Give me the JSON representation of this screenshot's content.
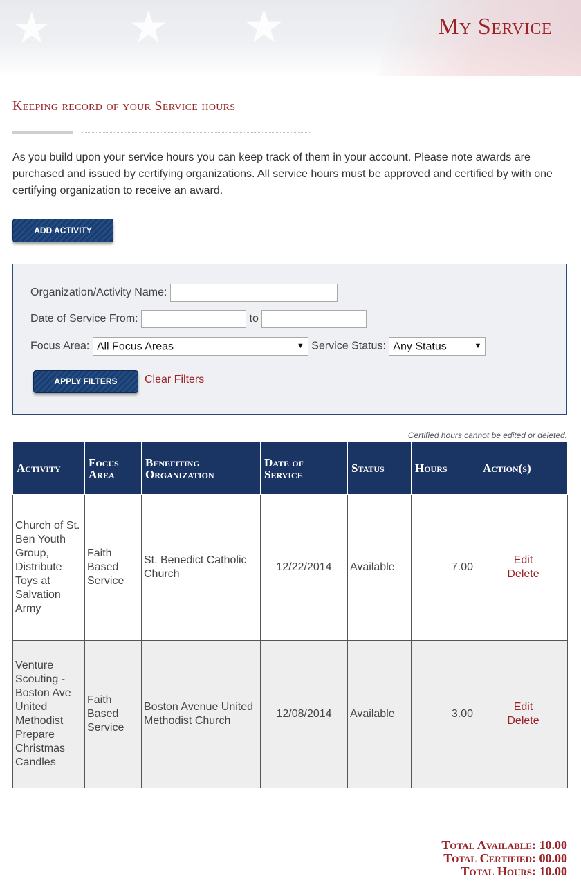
{
  "header": {
    "title": "My Service"
  },
  "section": {
    "heading": "Keeping record of your Service hours",
    "intro": "As you build upon your service hours you can keep track of them in your account. Please note awards are purchased and issued by certifying organizations. All service hours must be approved and certified by with one certifying organization to receive an award."
  },
  "actions": {
    "add_activity_label": "ADD ACTIVITY"
  },
  "filters": {
    "org_label": "Organization/Activity Name:",
    "org_value": "",
    "date_from_label": "Date of Service From:",
    "date_from_value": "",
    "date_to_label": "to",
    "date_to_value": "",
    "focus_label": "Focus Area:",
    "focus_value": "All Focus Areas",
    "status_label": "Service Status:",
    "status_value": "Any Status",
    "apply_label": "APPLY FILTERS",
    "clear_label": "Clear Filters"
  },
  "note": "Certified hours cannot be edited or deleted.",
  "table": {
    "headers": [
      "Activity",
      "Focus Area",
      "Benefiting Organization",
      "Date of Service",
      "Status",
      "Hours",
      "Action(s)"
    ],
    "rows": [
      {
        "activity": "Church of St. Ben Youth Group, Distribute Toys at Salvation Army",
        "focus": "Faith Based Service",
        "org": "St. Benedict Catholic Church",
        "date": "12/22/2014",
        "status": "Available",
        "hours": "7.00",
        "edit": "Edit",
        "delete": "Delete"
      },
      {
        "activity": "Venture Scouting - Boston Ave United Methodist Prepare Christmas Candles",
        "focus": "Faith Based Service",
        "org": "Boston Avenue United Methodist Church",
        "date": "12/08/2014",
        "status": "Available",
        "hours": "3.00",
        "edit": "Edit",
        "delete": "Delete"
      }
    ]
  },
  "totals": {
    "available": "Total Available: 10.00",
    "certified": "Total Certified: 00.00",
    "hours": "Total Hours: 10.00"
  },
  "colors": {
    "accent_red": "#9b2226",
    "navy": "#1a3564",
    "filter_bg": "#eef0f3"
  }
}
